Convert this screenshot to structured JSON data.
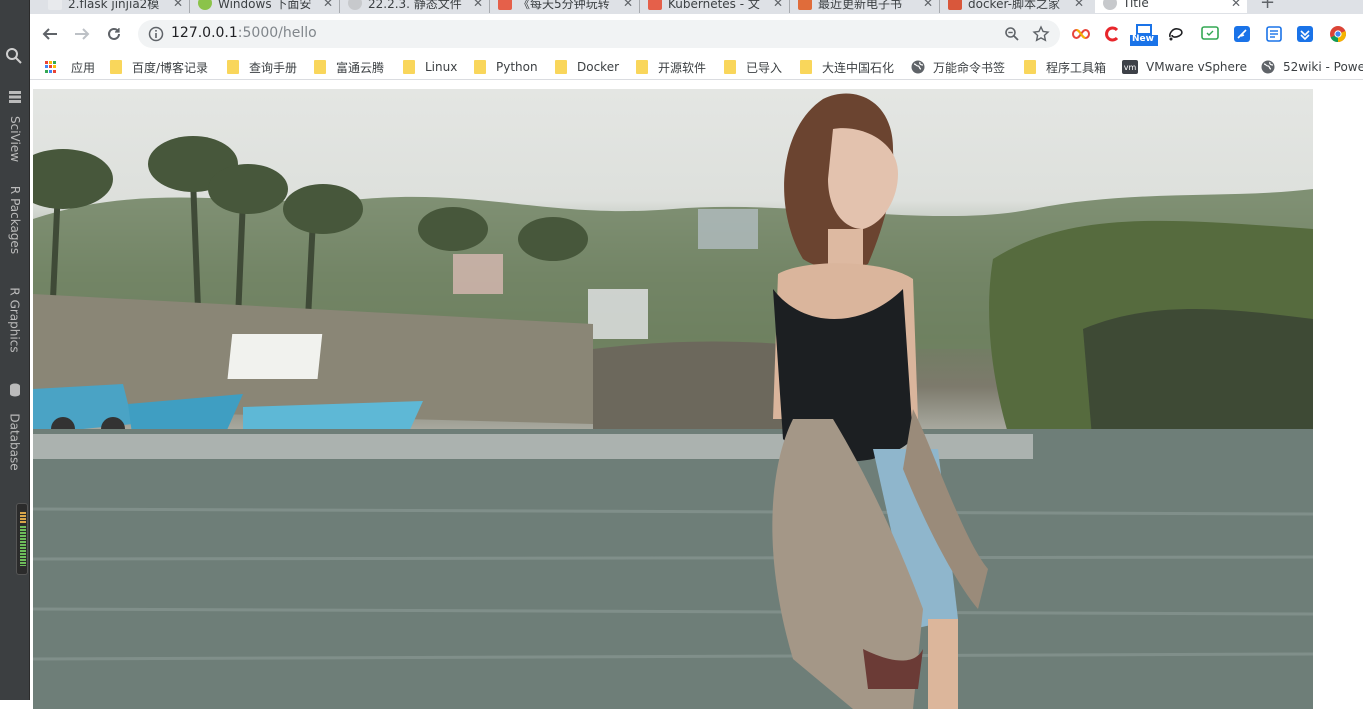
{
  "ide_panel": {
    "tabs": [
      "SciView",
      "R Packages",
      "R Graphics",
      "Database"
    ]
  },
  "browser": {
    "tabs": [
      {
        "title": "2.flask jinjia2模",
        "active": false
      },
      {
        "title": "Windows 下面安",
        "active": false
      },
      {
        "title": "22.2.3. 静态文件",
        "active": false
      },
      {
        "title": "《每天5分钟玩转",
        "active": false
      },
      {
        "title": "Kubernetes - 文",
        "active": false
      },
      {
        "title": "最近更新电子书",
        "active": false
      },
      {
        "title": "docker-脚本之家",
        "active": false
      },
      {
        "title": "Title",
        "active": true
      }
    ],
    "new_tab_label": "+",
    "address": {
      "host": "127.0.0.1",
      "path": ":5000/hello"
    },
    "bookmarks": [
      {
        "label": "应用",
        "kind": "apps"
      },
      {
        "label": "百度/博客记录",
        "kind": "folder"
      },
      {
        "label": "查询手册",
        "kind": "folder"
      },
      {
        "label": "富通云腾",
        "kind": "folder"
      },
      {
        "label": "Linux",
        "kind": "folder"
      },
      {
        "label": "Python",
        "kind": "folder"
      },
      {
        "label": "Docker",
        "kind": "folder"
      },
      {
        "label": "开源软件",
        "kind": "folder"
      },
      {
        "label": "已导入",
        "kind": "folder"
      },
      {
        "label": "大连中国石化",
        "kind": "folder"
      },
      {
        "label": "万能命令书签",
        "kind": "globe"
      },
      {
        "label": "程序工具箱",
        "kind": "folder"
      },
      {
        "label": "VMware vSphere",
        "kind": "vm"
      },
      {
        "label": "52wiki - Powe",
        "kind": "globe"
      }
    ],
    "extensions": [
      "infinity-icon",
      "c-icon",
      "new-badge-icon",
      "lasso-icon",
      "screen-icon",
      "feather-icon",
      "note-icon",
      "download-icon",
      "chrome-icon"
    ],
    "extension_badge": "New"
  },
  "page": {
    "image_alt": "photo"
  },
  "colors": {
    "ide_bg": "#3c3f41",
    "tabstrip_bg": "#dee1e6",
    "omnibox_bg": "#f1f3f4",
    "folder": "#f9d65b"
  }
}
